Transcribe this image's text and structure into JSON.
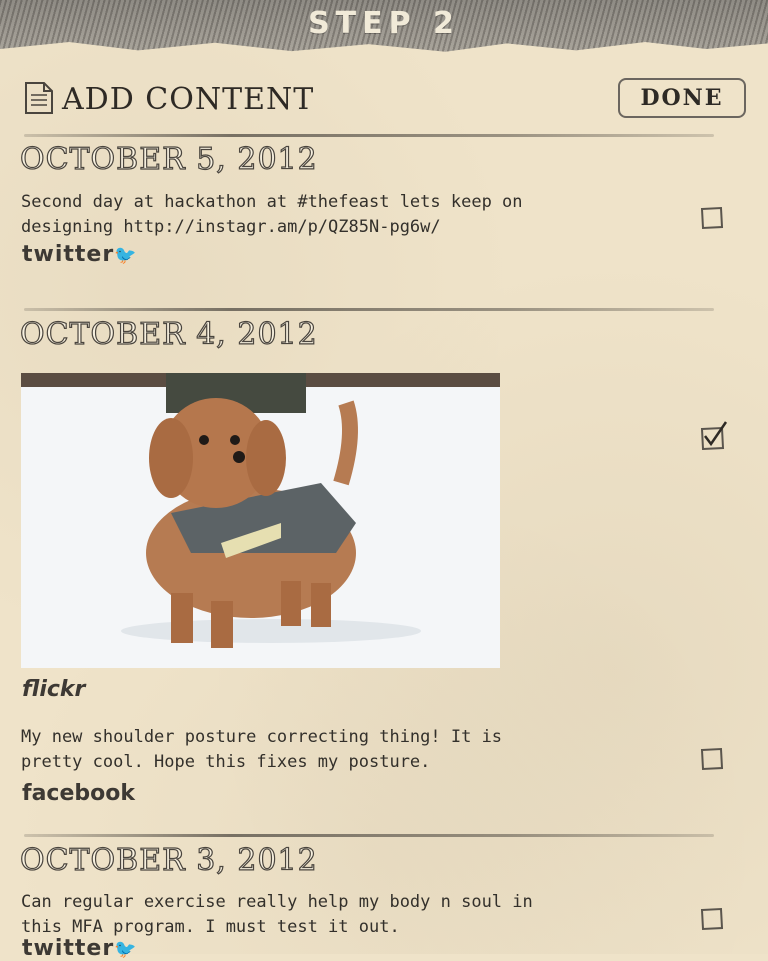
{
  "header": {
    "step_title": "STEP 2",
    "title": "ADD CONTENT",
    "done_label": "DONE"
  },
  "sections": [
    {
      "date": "OCTOBER 5, 2012",
      "posts": [
        {
          "text": "Second day at hackathon at #thefeast lets keep on designing http://instagr.am/p/QZ85N-pg6w/",
          "source": "twitter",
          "checked": false
        }
      ]
    },
    {
      "date": "OCTOBER 4, 2012",
      "posts": [
        {
          "type": "photo",
          "source": "flickr",
          "checked": true
        },
        {
          "text": "My new shoulder posture correcting thing! It is pretty cool. Hope this fixes my posture.",
          "source": "facebook",
          "checked": false
        }
      ]
    },
    {
      "date": "OCTOBER 3, 2012",
      "posts": [
        {
          "text": "Can regular exercise really help my body n soul in this MFA program. I must test it out.",
          "source": "twitter",
          "checked": false
        }
      ]
    }
  ],
  "colors": {
    "paper": "#efe3c9",
    "ink": "#3a342c",
    "pencil_band": "#8d8a84"
  },
  "icons": {
    "document": "document-icon",
    "checkbox_empty": "checkbox-icon",
    "checkbox_checked": "checkbox-checked-icon"
  }
}
